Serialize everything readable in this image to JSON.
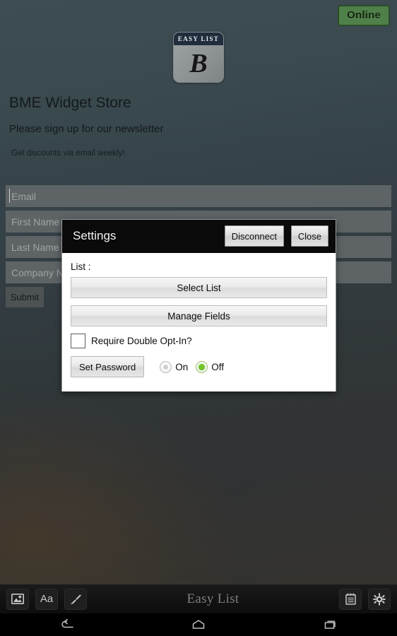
{
  "status": {
    "badge_label": "Online",
    "badge_color": "#4f8049"
  },
  "logo": {
    "band_text": "EASY LIST",
    "mark_letter": "B"
  },
  "page": {
    "store_title": "BME Widget Store",
    "newsletter_line": "Please sign up for our newsletter",
    "discount_line": "Get discounts via email weekly!"
  },
  "form": {
    "fields": [
      {
        "name": "email",
        "placeholder": "Email",
        "value": ""
      },
      {
        "name": "first_name",
        "placeholder": "First Name",
        "value": ""
      },
      {
        "name": "last_name",
        "placeholder": "Last Name",
        "value": ""
      },
      {
        "name": "company_name",
        "placeholder": "Company Name",
        "value": ""
      }
    ],
    "submit_label": "Submit"
  },
  "dialog": {
    "title": "Settings",
    "disconnect_label": "Disconnect",
    "close_label": "Close",
    "list_label": "List :",
    "select_list_label": "Select List",
    "manage_fields_label": "Manage Fields",
    "optin_label": "Require Double Opt-In?",
    "optin_checked": false,
    "set_password_label": "Set Password",
    "password_on_label": "On",
    "password_off_label": "Off",
    "password_selected": "Off"
  },
  "toolbar": {
    "title": "Easy List",
    "left_icons": [
      {
        "name": "image-icon"
      },
      {
        "name": "text-format-icon",
        "glyph": "Aa"
      },
      {
        "name": "brush-icon"
      }
    ],
    "right_icons": [
      {
        "name": "notepad-icon"
      },
      {
        "name": "gear-icon"
      }
    ]
  },
  "navbar": {
    "back_label": "Back",
    "home_label": "Home",
    "recents_label": "Recent apps"
  }
}
